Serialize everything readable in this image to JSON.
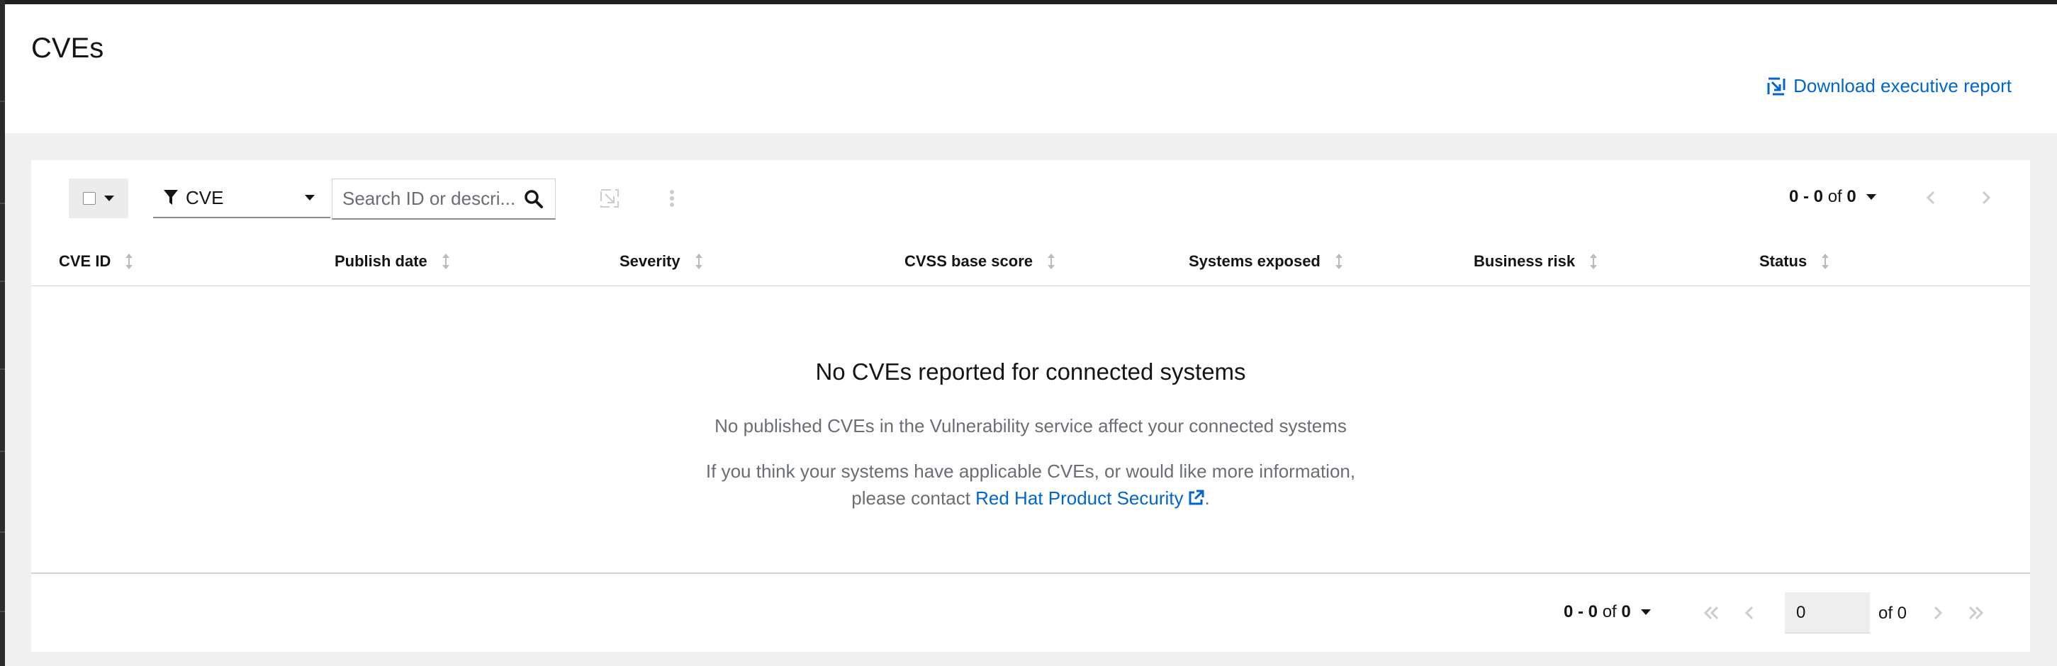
{
  "page": {
    "title": "CVEs",
    "download_label": "Download executive report"
  },
  "toolbar": {
    "filter_label": "CVE",
    "search_placeholder": "Search ID or descri...",
    "pagination": {
      "range": "0 - 0",
      "of_label": "of",
      "total": "0"
    }
  },
  "table": {
    "columns": [
      {
        "label": "CVE ID"
      },
      {
        "label": "Publish date"
      },
      {
        "label": "Severity"
      },
      {
        "label": "CVSS base score"
      },
      {
        "label": "Systems exposed"
      },
      {
        "label": "Business risk"
      },
      {
        "label": "Status"
      }
    ]
  },
  "empty_state": {
    "title": "No CVEs reported for connected systems",
    "line1": "No published CVEs in the Vulnerability service affect your connected systems",
    "line2": "If you think your systems have applicable CVEs, or would like more information,",
    "line3_prefix": "please contact ",
    "link_label": "Red Hat Product Security",
    "line3_suffix": "."
  },
  "footer": {
    "pagination": {
      "range": "0 - 0",
      "of_label": "of",
      "total": "0"
    },
    "page_value": "0",
    "of_pages": "of 0"
  },
  "colors": {
    "link": "#0066cc",
    "page_bg": "#f0f0f0",
    "card_bg": "#ffffff"
  }
}
